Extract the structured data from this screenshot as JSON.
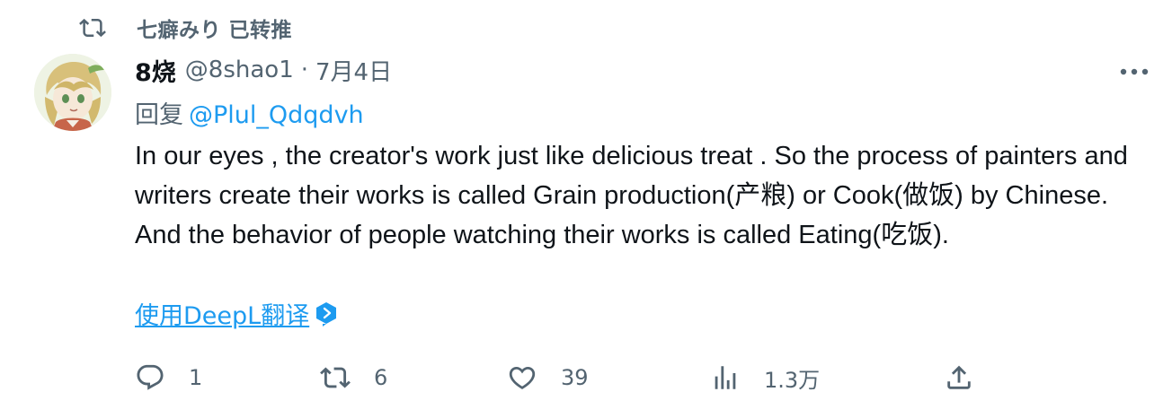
{
  "retweet_context": {
    "text": "七癖みり 已转推",
    "icon": "retweet-icon"
  },
  "tweet": {
    "author": {
      "display_name": "8烧",
      "handle": "@8shao1",
      "separator": "·",
      "date": "7月4日",
      "avatar": "avatar-image"
    },
    "more_icon": "more-icon",
    "reply": {
      "prefix": "回复",
      "mention": "@Plul_Qdqdvh"
    },
    "body": "In our eyes , the creator's work just like delicious treat . So the process of painters and writers create their works is called Grain production(产粮) or Cook(做饭) by Chinese. And the behavior of people watching their works is called Eating(吃饭).",
    "translate": {
      "label": "使用DeepL翻译",
      "icon": "deepl-icon"
    },
    "actions": {
      "reply": {
        "icon": "reply-icon",
        "count": "1"
      },
      "retweet": {
        "icon": "retweet-icon",
        "count": "6"
      },
      "like": {
        "icon": "heart-icon",
        "count": "39"
      },
      "views": {
        "icon": "views-icon",
        "count": "1.3万"
      },
      "share": {
        "icon": "share-icon"
      }
    }
  },
  "colors": {
    "text_primary": "#0f1419",
    "text_secondary": "#536471",
    "link": "#1d9bf0",
    "background": "#ffffff"
  }
}
